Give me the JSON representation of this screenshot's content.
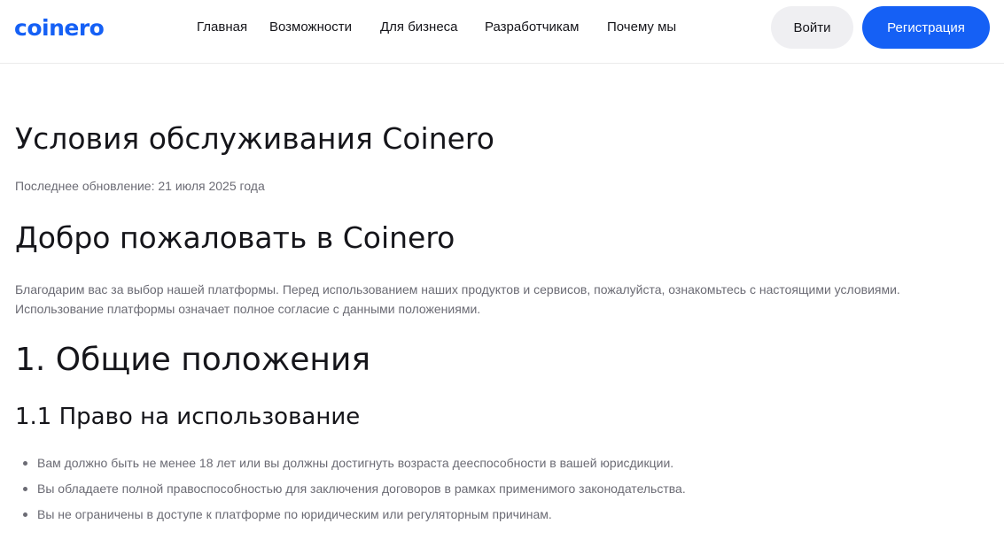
{
  "header": {
    "logo": "coinero",
    "nav": [
      {
        "label": "Главная"
      },
      {
        "label": "Возможности"
      },
      {
        "label": "Для бизнеса"
      },
      {
        "label": "Разработчикам"
      },
      {
        "label": "Почему мы"
      }
    ],
    "login_label": "Войти",
    "register_label": "Регистрация"
  },
  "colors": {
    "brand": "#1560f5",
    "login_bg": "#efeff2",
    "muted_text": "#6b6b74"
  },
  "main": {
    "title": "Условия обслуживания Coinero",
    "last_updated": "Последнее обновление: 21 июля 2025 года",
    "welcome_heading": "Добро пожаловать в Coinero",
    "intro": "Благодарим вас за выбор нашей платформы. Перед использованием наших продуктов и сервисов, пожалуйста, ознакомьтесь с настоящими условиями. Использование платформы означает полное согласие с данными положениями.",
    "section_heading": "1. Общие положения",
    "subsection_heading": "1.1 Право на использование",
    "rules": [
      "Вам должно быть не менее 18 лет или вы должны достигнуть возраста дееспособности в вашей юрисдикции.",
      "Вы обладаете полной правоспособностью для заключения договоров в рамках применимого законодательства.",
      "Вы не ограничены в доступе к платформе по юридическим или регуляторным причинам."
    ]
  }
}
